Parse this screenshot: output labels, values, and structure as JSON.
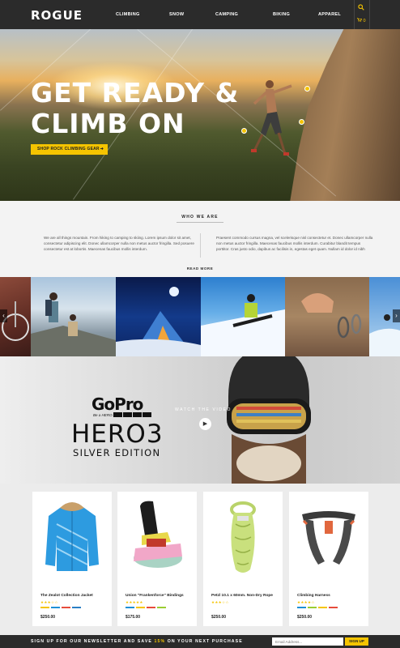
{
  "brand": {
    "logo": "ROGUE",
    "accent": "#f5c400",
    "dark": "#2b2b2b"
  },
  "nav": {
    "items": [
      "CLIMBING",
      "SNOW",
      "CAMPING",
      "BIKING",
      "APPAREL"
    ],
    "cart_count": "0"
  },
  "hero": {
    "title_line1": "GET READY &",
    "title_line2": "CLIMB ON",
    "cta": "SHOP ROCK CLIMBING GEAR"
  },
  "about": {
    "heading": "WHO WE ARE",
    "left": "We are all things mountain. From hiking to camping to skiing. Lorem ipsum dolor sit amet, consectetur adipiscing elit. Donec ullamcorper nulla non metus auctor fringilla. Sed posuere consectetur est at lobortis. Maecenas faucibus mollis interdum.",
    "right": "Praesent commodo cursus magna, vel scelerisque nisl consectetur et. Donec ullamcorper nulla non metus auctor fringilla. Maecenas faucibus mollis interdum. Curabitur blandit tempus porttitor. Cras justo odio, dapibus ac facilisis in, egestas eget quam. Nullam id dolor id nibh",
    "read_more": "READ MORE"
  },
  "gallery": {
    "tiles": [
      "bike",
      "hikers",
      "camping",
      "snowboard",
      "climbing-hand",
      "skier"
    ]
  },
  "video": {
    "brand": "GoPro",
    "tagline": "Be a HERO.",
    "model": "HERO3",
    "edition": "SILVER EDITION",
    "watch": "WATCH THE VIDEO"
  },
  "products": [
    {
      "name": "The Zealot Collection Jacket",
      "stars": "★★★☆☆",
      "price": "$250.00",
      "swatches": [
        "#f5c400",
        "#1e90d6",
        "#e74c3c",
        "#2b7fc4"
      ]
    },
    {
      "name": "Union \"Frankenforce\" Bindings",
      "stars": "★★★★★",
      "price": "$175.00",
      "swatches": [
        "#1e90d6",
        "#f5c400",
        "#e74c3c",
        "#9acd32"
      ]
    },
    {
      "name": "Petzl 10.1 x 60mm. Non-Dry Rope",
      "stars": "★★★☆☆",
      "price": "$250.00",
      "swatches": []
    },
    {
      "name": "Climbing Harness",
      "stars": "★★★★☆",
      "price": "$250.00",
      "swatches": [
        "#1e90d6",
        "#9acd32",
        "#f5c400",
        "#e74c3c"
      ]
    }
  ],
  "newsletter": {
    "text_before": "SIGN UP FOR OUR NEWSLETTER AND SAVE ",
    "highlight": "15%",
    "text_after": " ON YOUR NEXT PURCHASE",
    "placeholder": "Email Address...",
    "button": "SIGN UP"
  }
}
